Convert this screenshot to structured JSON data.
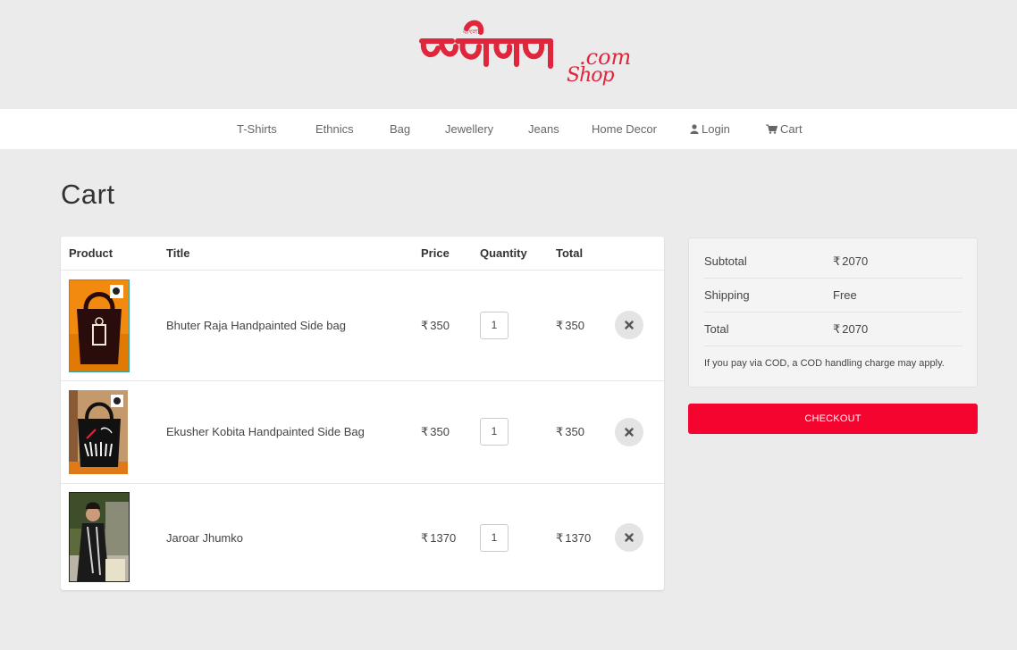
{
  "brand": {
    "logo_text": "বাংলা",
    "logo_suffix": ".com",
    "logo_shop": "Shop",
    "accent_color": "#e0263d"
  },
  "nav": {
    "items": [
      {
        "label": "T-Shirts"
      },
      {
        "label": "Ethnics"
      },
      {
        "label": "Bag"
      },
      {
        "label": "Jewellery"
      },
      {
        "label": "Jeans"
      },
      {
        "label": "Home Decor"
      },
      {
        "label": "Login",
        "icon": "user-icon"
      },
      {
        "label": "Cart",
        "icon": "cart-icon"
      }
    ]
  },
  "page": {
    "title": "Cart"
  },
  "cart": {
    "headers": {
      "product": "Product",
      "title": "Title",
      "price": "Price",
      "quantity": "Quantity",
      "total": "Total"
    },
    "currency_symbol": "₹",
    "items": [
      {
        "title": "Bhuter Raja Handpainted Side bag",
        "price": "350",
        "quantity": "1",
        "total": "350",
        "thumb_icon": "black-tote-bag-image"
      },
      {
        "title": "Ekusher Kobita Handpainted Side Bag",
        "price": "350",
        "quantity": "1",
        "total": "350",
        "thumb_icon": "black-tote-bag-image"
      },
      {
        "title": "Jaroar Jhumko",
        "price": "1370",
        "quantity": "1",
        "total": "1370",
        "thumb_icon": "model-photo-image"
      }
    ]
  },
  "summary": {
    "subtotal_label": "Subtotal",
    "subtotal_value": "2070",
    "shipping_label": "Shipping",
    "shipping_value": "Free",
    "total_label": "Total",
    "total_value": "2070",
    "note": "If you pay via COD, a COD handling charge may apply."
  },
  "checkout": {
    "label": "CHECKOUT",
    "color": "#f5042f"
  }
}
